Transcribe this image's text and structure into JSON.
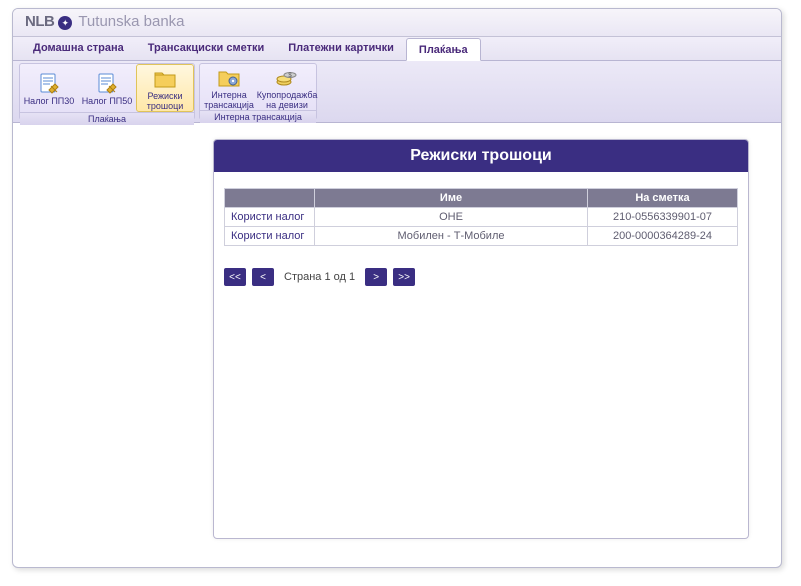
{
  "brand": {
    "short": "NLB",
    "name": "Tutunska banka"
  },
  "menu": {
    "items": [
      "Домашна страна",
      "Трансакциски сметки",
      "Платежни картички",
      "Плаќања"
    ],
    "activeIndex": 3
  },
  "ribbon": {
    "groups": [
      {
        "title": "Плаќања",
        "buttons": [
          {
            "label": "Налог ПП30",
            "icon": "doc-edit",
            "selected": false
          },
          {
            "label": "Налог ПП50",
            "icon": "doc-edit",
            "selected": false
          },
          {
            "label": "Режиски\nтрошоци",
            "icon": "folder",
            "selected": true
          }
        ]
      },
      {
        "title": "Интерна трансакција",
        "buttons": [
          {
            "label": "Интерна\nтрансакција",
            "icon": "folder-gear",
            "selected": false
          },
          {
            "label": "Купопродажба\nна девизи",
            "icon": "coins",
            "selected": false
          }
        ]
      }
    ]
  },
  "panel": {
    "title": "Режиски трошоци",
    "columns": [
      "",
      "Име",
      "На сметка"
    ],
    "rows": [
      {
        "action": "Користи налог",
        "name": "ОНЕ",
        "account": "210-0556339901-07"
      },
      {
        "action": "Користи налог",
        "name": "Мобилен - Т-Мобиле",
        "account": "200-0000364289-24"
      }
    ]
  },
  "pager": {
    "first": "<<",
    "prev": "<",
    "label": "Страна 1 од 1",
    "next": ">",
    "last": ">>"
  }
}
